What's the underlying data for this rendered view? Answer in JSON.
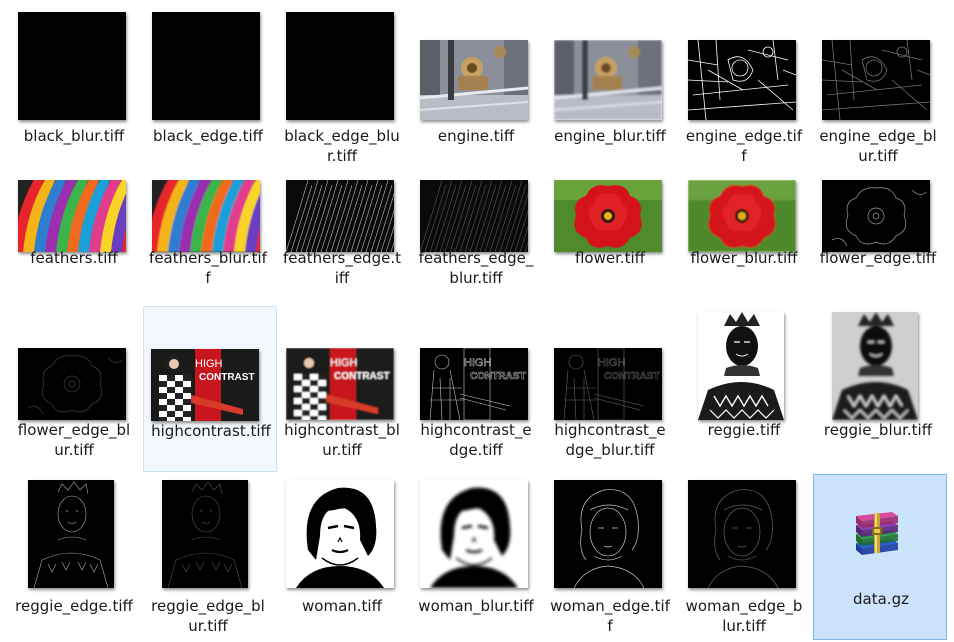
{
  "files": [
    {
      "id": "black_blur",
      "label": [
        "black_blur.tiff"
      ]
    },
    {
      "id": "black_edge",
      "label": [
        "black_edge.tiff"
      ]
    },
    {
      "id": "black_edge_blur",
      "label": [
        "black_edge_blu",
        "r.tiff"
      ]
    },
    {
      "id": "engine",
      "label": [
        "engine.tiff"
      ]
    },
    {
      "id": "engine_blur",
      "label": [
        "engine_blur.tiff"
      ]
    },
    {
      "id": "engine_edge",
      "label": [
        "engine_edge.tif",
        "f"
      ]
    },
    {
      "id": "engine_edge_blur",
      "label": [
        "engine_edge_bl",
        "ur.tiff"
      ]
    },
    {
      "id": "feathers",
      "label": [
        "feathers.tiff"
      ]
    },
    {
      "id": "feathers_blur",
      "label": [
        "feathers_blur.tif",
        "f"
      ]
    },
    {
      "id": "feathers_edge",
      "label": [
        "feathers_edge.t",
        "iff"
      ]
    },
    {
      "id": "feathers_edge_blur",
      "label": [
        "feathers_edge_",
        "blur.tiff"
      ]
    },
    {
      "id": "flower",
      "label": [
        "flower.tiff"
      ]
    },
    {
      "id": "flower_blur",
      "label": [
        "flower_blur.tiff"
      ]
    },
    {
      "id": "flower_edge",
      "label": [
        "flower_edge.tiff"
      ]
    },
    {
      "id": "flower_edge_blur",
      "label": [
        "flower_edge_bl",
        "ur.tiff"
      ]
    },
    {
      "id": "highcontrast",
      "label": [
        "highcontrast.tiff"
      ]
    },
    {
      "id": "highcontrast_blur",
      "label": [
        "highcontrast_bl",
        "ur.tiff"
      ]
    },
    {
      "id": "highcontrast_edge",
      "label": [
        "highcontrast_e",
        "dge.tiff"
      ]
    },
    {
      "id": "highcontrast_edge_blur",
      "label": [
        "highcontrast_e",
        "dge_blur.tiff"
      ]
    },
    {
      "id": "reggie",
      "label": [
        "reggie.tiff"
      ]
    },
    {
      "id": "reggie_blur",
      "label": [
        "reggie_blur.tiff"
      ]
    },
    {
      "id": "reggie_edge",
      "label": [
        "reggie_edge.tiff"
      ]
    },
    {
      "id": "reggie_edge_blur",
      "label": [
        "reggie_edge_bl",
        "ur.tiff"
      ]
    },
    {
      "id": "woman",
      "label": [
        "woman.tiff"
      ]
    },
    {
      "id": "woman_blur",
      "label": [
        "woman_blur.tiff"
      ]
    },
    {
      "id": "woman_edge",
      "label": [
        "woman_edge.tif",
        "f"
      ]
    },
    {
      "id": "woman_edge_blur",
      "label": [
        "woman_edge_b",
        "lur.tiff"
      ]
    },
    {
      "id": "data_gz",
      "label": [
        "data.gz"
      ]
    }
  ],
  "thumb_text": {
    "high": "HIGH",
    "contrast": "CONTRAST"
  },
  "hover_item": "highcontrast",
  "selected_item": "data_gz"
}
